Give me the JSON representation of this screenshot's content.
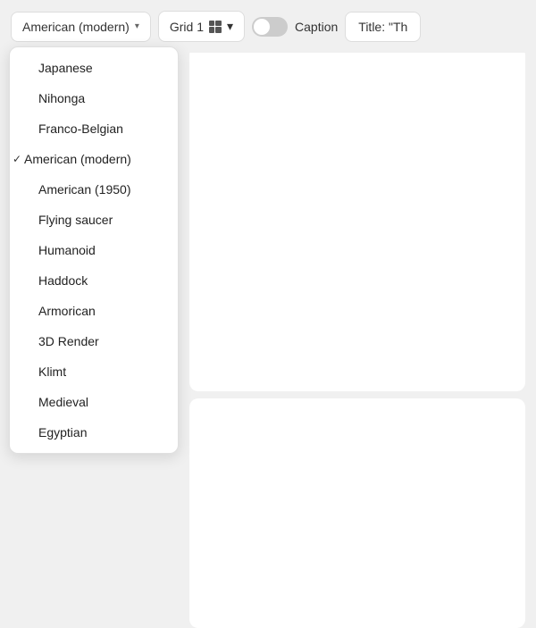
{
  "toolbar": {
    "style_dropdown_label": "American (modern)",
    "style_dropdown_chevron": "▾",
    "grid_dropdown_label": "Grid 1",
    "grid_dropdown_chevron": "▾",
    "caption_label": "Caption",
    "title_label": "Title: \"Th",
    "sparkle": "✦"
  },
  "dropdown": {
    "items": [
      {
        "id": "japanese",
        "label": "Japanese",
        "selected": false
      },
      {
        "id": "nihonga",
        "label": "Nihonga",
        "selected": false
      },
      {
        "id": "franco-belgian",
        "label": "Franco-Belgian",
        "selected": false
      },
      {
        "id": "american-modern",
        "label": "American (modern)",
        "selected": true
      },
      {
        "id": "american-1950",
        "label": "American (1950)",
        "selected": false
      },
      {
        "id": "flying-saucer",
        "label": "Flying saucer",
        "selected": false
      },
      {
        "id": "humanoid",
        "label": "Humanoid",
        "selected": false
      },
      {
        "id": "haddock",
        "label": "Haddock",
        "selected": false
      },
      {
        "id": "armorican",
        "label": "Armorican",
        "selected": false
      },
      {
        "id": "3d-render",
        "label": "3D Render",
        "selected": false
      },
      {
        "id": "klimt",
        "label": "Klimt",
        "selected": false
      },
      {
        "id": "medieval",
        "label": "Medieval",
        "selected": false
      },
      {
        "id": "egyptian",
        "label": "Egyptian",
        "selected": false
      }
    ]
  }
}
